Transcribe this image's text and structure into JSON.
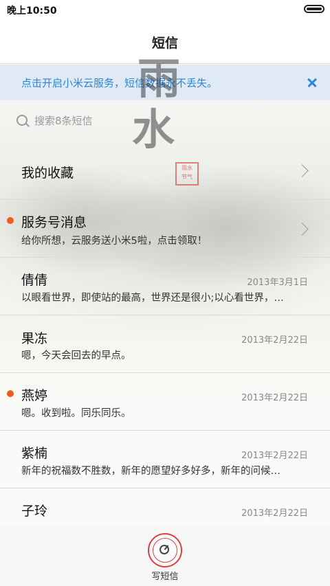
{
  "status_bar": {
    "time": "晚上10:50"
  },
  "header": {
    "title": "短信"
  },
  "background": {
    "char_top": "雨",
    "char_bottom": "水"
  },
  "banner": {
    "text": "点击开启小米云服务，短信数据永不丢失。"
  },
  "search": {
    "placeholder": "搜索8条短信"
  },
  "favorites": {
    "title": "我的收藏"
  },
  "service": {
    "title": "服务号消息",
    "subtitle": "给你所想，云服务送小米5啦，点击领取！",
    "unread": true
  },
  "messages": [
    {
      "name": "倩倩",
      "date": "2013年3月1日",
      "preview": "以眼看世界，即使站的最高，世界还是很小;以心看世界，…",
      "unread": false
    },
    {
      "name": "果冻",
      "date": "2013年2月22日",
      "preview": "嗯，今天会回去的早点。",
      "unread": false
    },
    {
      "name": "燕婷",
      "date": "2013年2月22日",
      "preview": "嗯。收到啦。同乐同乐。",
      "unread": true
    },
    {
      "name": "紫楠",
      "date": "2013年2月22日",
      "preview": "新年的祝福数不胜数，新年的愿望好多好多，新年的问候…",
      "unread": false
    },
    {
      "name": "子玲",
      "date": "2013年2月22日",
      "preview": "",
      "unread": false
    }
  ],
  "compose": {
    "label": "写短信"
  },
  "colors": {
    "accent_blue": "#2a86d6",
    "unread_dot": "#f05a1a",
    "compose_ring": "#e23c3c"
  }
}
